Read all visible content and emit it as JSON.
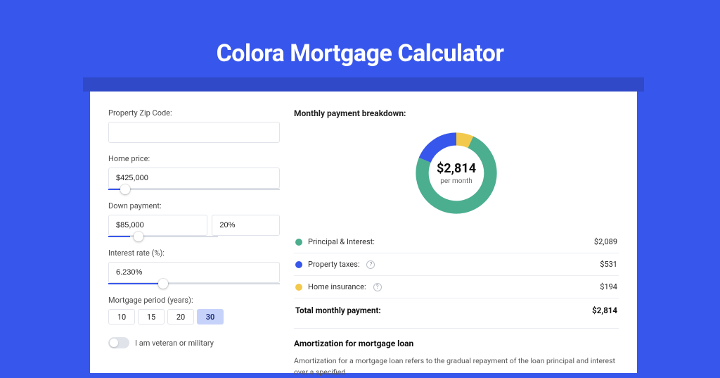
{
  "header": {
    "title": "Colora Mortgage Calculator"
  },
  "form": {
    "zip": {
      "label": "Property Zip Code:",
      "value": ""
    },
    "price": {
      "label": "Home price:",
      "value": "$425,000",
      "slider_pct": 10
    },
    "down": {
      "label": "Down payment:",
      "amount": "$85,000",
      "percent": "20%",
      "slider_pct": 20
    },
    "rate": {
      "label": "Interest rate (%):",
      "value": "6.230%",
      "slider_pct": 32
    },
    "period": {
      "label": "Mortgage period (years):",
      "options": [
        "10",
        "15",
        "20",
        "30"
      ],
      "active": "30"
    },
    "veteran": {
      "label": "I am veteran or military",
      "on": false
    }
  },
  "breakdown": {
    "title": "Monthly payment breakdown:",
    "center_value": "$2,814",
    "center_sub": "per month",
    "items": [
      {
        "label": "Principal & Interest:",
        "value": "$2,089",
        "color": "#4bae8f",
        "tooltip": false
      },
      {
        "label": "Property taxes:",
        "value": "$531",
        "color": "#3756eb",
        "tooltip": true
      },
      {
        "label": "Home insurance:",
        "value": "$194",
        "color": "#f2c94c",
        "tooltip": true
      }
    ],
    "total_label": "Total monthly payment:",
    "total_value": "$2,814"
  },
  "amortization": {
    "title": "Amortization for mortgage loan",
    "text": "Amortization for a mortgage loan refers to the gradual repayment of the loan principal and interest over a specified"
  },
  "chart_data": {
    "type": "pie",
    "title": "Monthly payment breakdown",
    "total_label": "$2,814 per month",
    "series": [
      {
        "name": "Principal & Interest",
        "value": 2089,
        "color": "#4bae8f"
      },
      {
        "name": "Property taxes",
        "value": 531,
        "color": "#3756eb"
      },
      {
        "name": "Home insurance",
        "value": 194,
        "color": "#f2c94c"
      }
    ],
    "total": 2814
  }
}
